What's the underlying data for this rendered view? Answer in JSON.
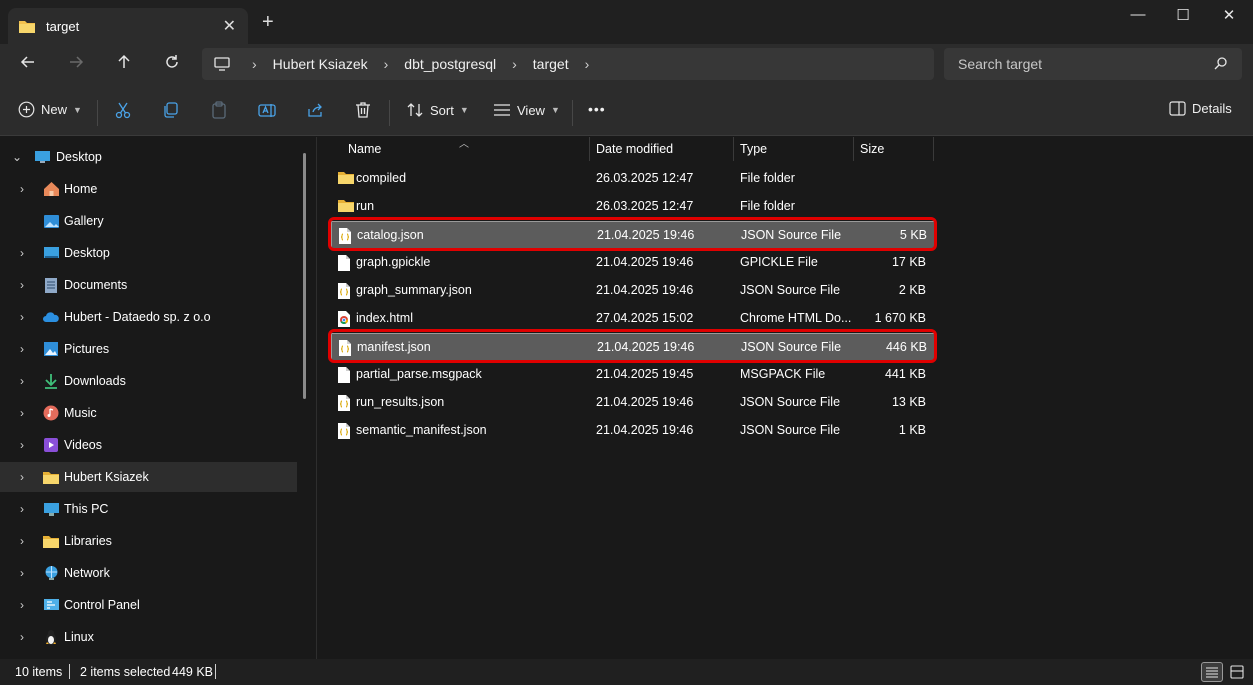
{
  "window": {
    "tab_title": "target",
    "tab_close": "✕",
    "new_tab": "+",
    "minimize": "—",
    "maximize": "☐",
    "close": "✕"
  },
  "address": {
    "crumbs": [
      "Hubert Ksiazek",
      "dbt_postgresql",
      "target"
    ],
    "search_placeholder": "Search target"
  },
  "commands": {
    "new": "New",
    "sort": "Sort",
    "view": "View",
    "more": "•••",
    "details": "Details"
  },
  "sidebar": {
    "items": [
      {
        "label": "Desktop",
        "icon": "desktop-icon",
        "expanded": true
      },
      {
        "label": "Home",
        "icon": "home-icon"
      },
      {
        "label": "Gallery",
        "icon": "gallery-icon"
      },
      {
        "label": "Desktop",
        "icon": "desktop-icon"
      },
      {
        "label": "Documents",
        "icon": "documents-icon"
      },
      {
        "label": "Hubert - Dataedo sp. z o.o",
        "icon": "onedrive-icon"
      },
      {
        "label": "Pictures",
        "icon": "pictures-icon"
      },
      {
        "label": "Downloads",
        "icon": "downloads-icon"
      },
      {
        "label": "Music",
        "icon": "music-icon"
      },
      {
        "label": "Videos",
        "icon": "videos-icon"
      },
      {
        "label": "Hubert Ksiazek",
        "icon": "folder-icon",
        "selected": true
      },
      {
        "label": "This PC",
        "icon": "this-pc-icon"
      },
      {
        "label": "Libraries",
        "icon": "libraries-icon"
      },
      {
        "label": "Network",
        "icon": "network-icon"
      },
      {
        "label": "Control Panel",
        "icon": "control-panel-icon"
      },
      {
        "label": "Linux",
        "icon": "linux-icon"
      }
    ]
  },
  "columns": {
    "name": "Name",
    "date": "Date modified",
    "type": "Type",
    "size": "Size"
  },
  "files": [
    {
      "name": "compiled",
      "date": "26.03.2025 12:47",
      "type": "File folder",
      "size": "",
      "kind": "folder"
    },
    {
      "name": "run",
      "date": "26.03.2025 12:47",
      "type": "File folder",
      "size": "",
      "kind": "folder"
    },
    {
      "name": "catalog.json",
      "date": "21.04.2025 19:46",
      "type": "JSON Source File",
      "size": "5 KB",
      "kind": "json",
      "selected": true
    },
    {
      "name": "graph.gpickle",
      "date": "21.04.2025 19:46",
      "type": "GPICKLE File",
      "size": "17 KB",
      "kind": "blank"
    },
    {
      "name": "graph_summary.json",
      "date": "21.04.2025 19:46",
      "type": "JSON Source File",
      "size": "2 KB",
      "kind": "json"
    },
    {
      "name": "index.html",
      "date": "27.04.2025 15:02",
      "type": "Chrome HTML Do...",
      "size": "1 670 KB",
      "kind": "chrome"
    },
    {
      "name": "manifest.json",
      "date": "21.04.2025 19:46",
      "type": "JSON Source File",
      "size": "446 KB",
      "kind": "json",
      "selected": true
    },
    {
      "name": "partial_parse.msgpack",
      "date": "21.04.2025 19:45",
      "type": "MSGPACK File",
      "size": "441 KB",
      "kind": "blank"
    },
    {
      "name": "run_results.json",
      "date": "21.04.2025 19:46",
      "type": "JSON Source File",
      "size": "13 KB",
      "kind": "json"
    },
    {
      "name": "semantic_manifest.json",
      "date": "21.04.2025 19:46",
      "type": "JSON Source File",
      "size": "1 KB",
      "kind": "json"
    }
  ],
  "status": {
    "items": "10 items",
    "selected": "2 items selected",
    "size": "449 KB"
  },
  "colors": {
    "highlight": "#e00000",
    "selection": "#5c5c5c",
    "folder": "#f2c14e"
  }
}
